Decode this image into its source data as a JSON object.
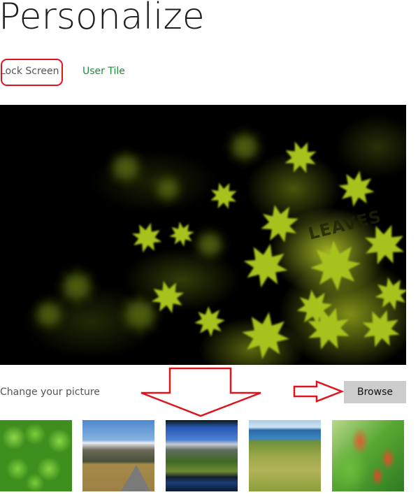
{
  "page": {
    "title": "Personalize"
  },
  "tabs": [
    {
      "label": "Lock Screen",
      "selected": true
    },
    {
      "label": "User Tile",
      "selected": false
    }
  ],
  "colors": {
    "tab_accent": "#1f8a3c",
    "annotation_red": "#e0141e",
    "browse_bg": "#cccccc"
  },
  "preview": {
    "description": "Lock screen preview image of glowing yellow-green maple leaves on black",
    "overlay_text": "LEAVES"
  },
  "change_picture": {
    "label": "Change your picture",
    "browse_label": "Browse"
  },
  "thumbnails": [
    {
      "name": "clover-leaves"
    },
    {
      "name": "mountain-road"
    },
    {
      "name": "mountain-lake"
    },
    {
      "name": "coastal-grassland"
    },
    {
      "name": "red-flowers"
    }
  ],
  "annotations": [
    {
      "type": "rounded-rectangle",
      "target": "Lock Screen tab"
    },
    {
      "type": "arrow-down",
      "target": "thumbnails"
    },
    {
      "type": "arrow-right",
      "target": "Browse button"
    }
  ]
}
